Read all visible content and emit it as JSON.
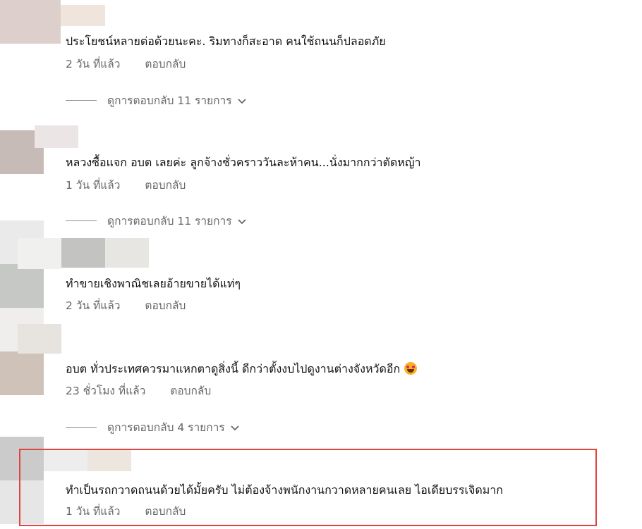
{
  "comments": [
    {
      "text": "ประโยชน์หลายต่อด้วยนะคะ. ริมทางก็สะอาด คนใช้ถนนก็ปลอดภัย",
      "time": "2 วัน ที่แล้ว",
      "reply_label": "ตอบกลับ",
      "replies_label": "ดูการตอบกลับ 11 รายการ"
    },
    {
      "text": "หลวงซื้อแจก อบต เลยค่ะ ลูกจ้างชั่วคราววันละห้าคน...นั่งมากกว่าตัดหญ้า",
      "time": "1 วัน ที่แล้ว",
      "reply_label": "ตอบกลับ",
      "replies_label": "ดูการตอบกลับ 11 รายการ"
    },
    {
      "text": "ทำขายเชิงพาณิชเลยอ้ายขายได้แท่ๆ",
      "time": "2 วัน ที่แล้ว",
      "reply_label": "ตอบกลับ"
    },
    {
      "text": "อบต ทั่วประเทศควรมาแหกตาดูสิ่งนี้ ดีกว่าตั้งงบไปดูงานต่างจังหวัดอีก",
      "emoji": "grinning-face-icon",
      "time": "23 ชั่วโมง ที่แล้ว",
      "reply_label": "ตอบกลับ",
      "replies_label": "ดูการตอบกลับ 4 รายการ"
    },
    {
      "text": "ทำเป็นรถกวาดถนนด้วยได้มั้ยครับ ไม่ต้องจ้างพนักงานกวาดหลายคนเลย ไอเดียบรรเจิดมาก",
      "time": "1 วัน ที่แล้ว",
      "reply_label": "ตอบกลับ"
    }
  ],
  "colors": {
    "text": "#111111",
    "meta": "#65676b",
    "highlight_border": "#e0453f"
  }
}
